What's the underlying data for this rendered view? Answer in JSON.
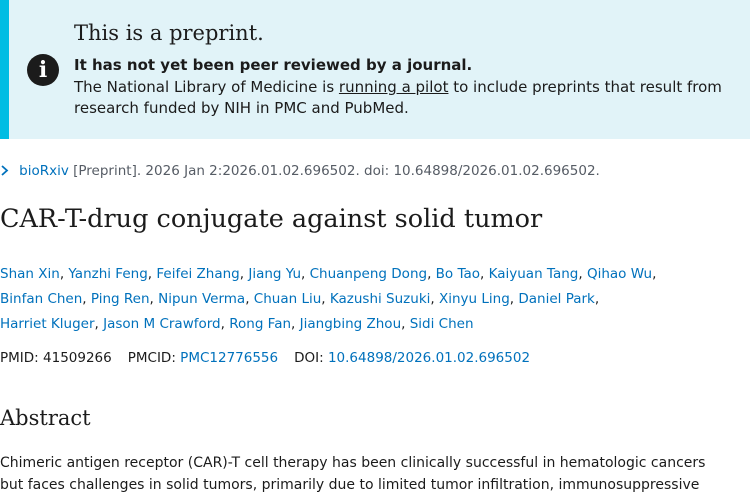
{
  "banner": {
    "icon": "info-icon",
    "title": "This is a preprint.",
    "subtitle": "It has not yet been peer reviewed by a journal.",
    "text_before_link": "The National Library of Medicine is ",
    "link_text": "running a pilot",
    "text_after_link_line1": " to include preprints that result from",
    "text_line2": "research funded by NIH in PMC and PubMed."
  },
  "citation": {
    "chevron_icon": "chevron-right-icon",
    "source_link": "bioRxiv",
    "text": " [Preprint]. 2026 Jan 2:2026.01.02.696502. doi: 10.64898/2026.01.02.696502."
  },
  "article": {
    "title": "CAR-T-drug conjugate against solid tumor",
    "authors_line1": [
      "Shan Xin",
      "Yanzhi Feng",
      "Feifei Zhang",
      "Jiang Yu",
      "Chuanpeng Dong",
      "Bo Tao",
      "Kaiyuan Tang",
      "Qihao Wu"
    ],
    "authors_line2": [
      "Binfan Chen",
      "Ping Ren",
      "Nipun Verma",
      "Chuan Liu",
      "Kazushi Suzuki",
      "Xinyu Ling",
      "Daniel Park"
    ],
    "authors_line3": [
      "Harriet Kluger",
      "Jason M Crawford",
      "Rong Fan",
      "Jiangbing Zhou",
      "Sidi Chen"
    ]
  },
  "identifiers": {
    "pmid_label": "PMID: ",
    "pmid": "41509266",
    "pmcid_label": "PMCID: ",
    "pmcid": "PMC12776556",
    "doi_label": "DOI: ",
    "doi": "10.64898/2026.01.02.696502"
  },
  "abstract": {
    "heading": "Abstract",
    "line1": "Chimeric antigen receptor (CAR)-T cell therapy has been clinically successful in hematologic cancers",
    "line2": "but faces challenges in solid tumors, primarily due to limited tumor infiltration, immunosuppressive"
  }
}
